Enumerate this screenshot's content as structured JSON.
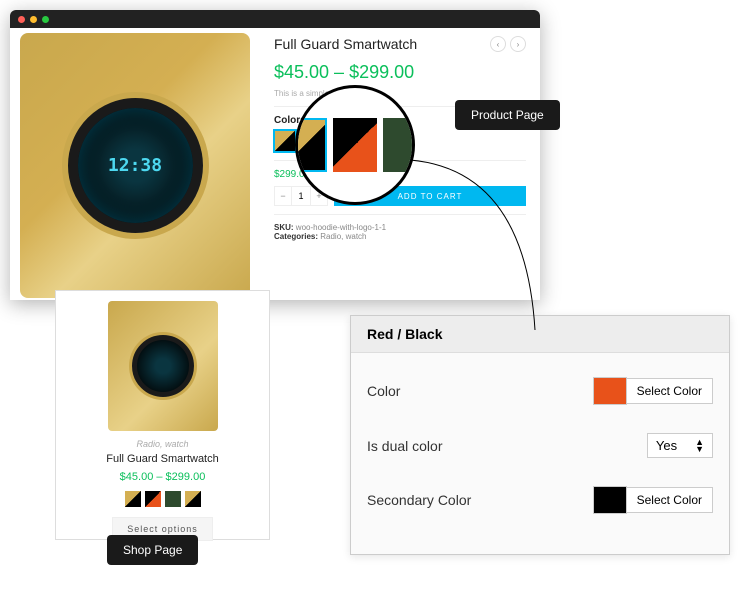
{
  "product": {
    "title": "Full Guard Smartwatch",
    "price_range": "$45.00 – $299.00",
    "description": "This is a simple pro",
    "colors_label": "Colors",
    "variant_price": "$299.00",
    "qty": "1",
    "add_to_cart": "ADD TO CART",
    "sku_label": "SKU:",
    "sku": "woo-hoodie-with-logo-1-1",
    "categories_label": "Categories:",
    "categories": "Radio, watch",
    "watch_time": "12:38"
  },
  "tooltips": {
    "product_page": "Product Page",
    "shop_page": "Shop Page"
  },
  "shop": {
    "category": "Radio, watch",
    "title": "Full Guard Smartwatch",
    "price": "$45.00 – $299.00",
    "button": "Select options"
  },
  "settings": {
    "header": "Red / Black",
    "color_label": "Color",
    "dual_label": "Is dual color",
    "dual_value": "Yes",
    "secondary_label": "Secondary Color",
    "select_color": "Select Color"
  }
}
